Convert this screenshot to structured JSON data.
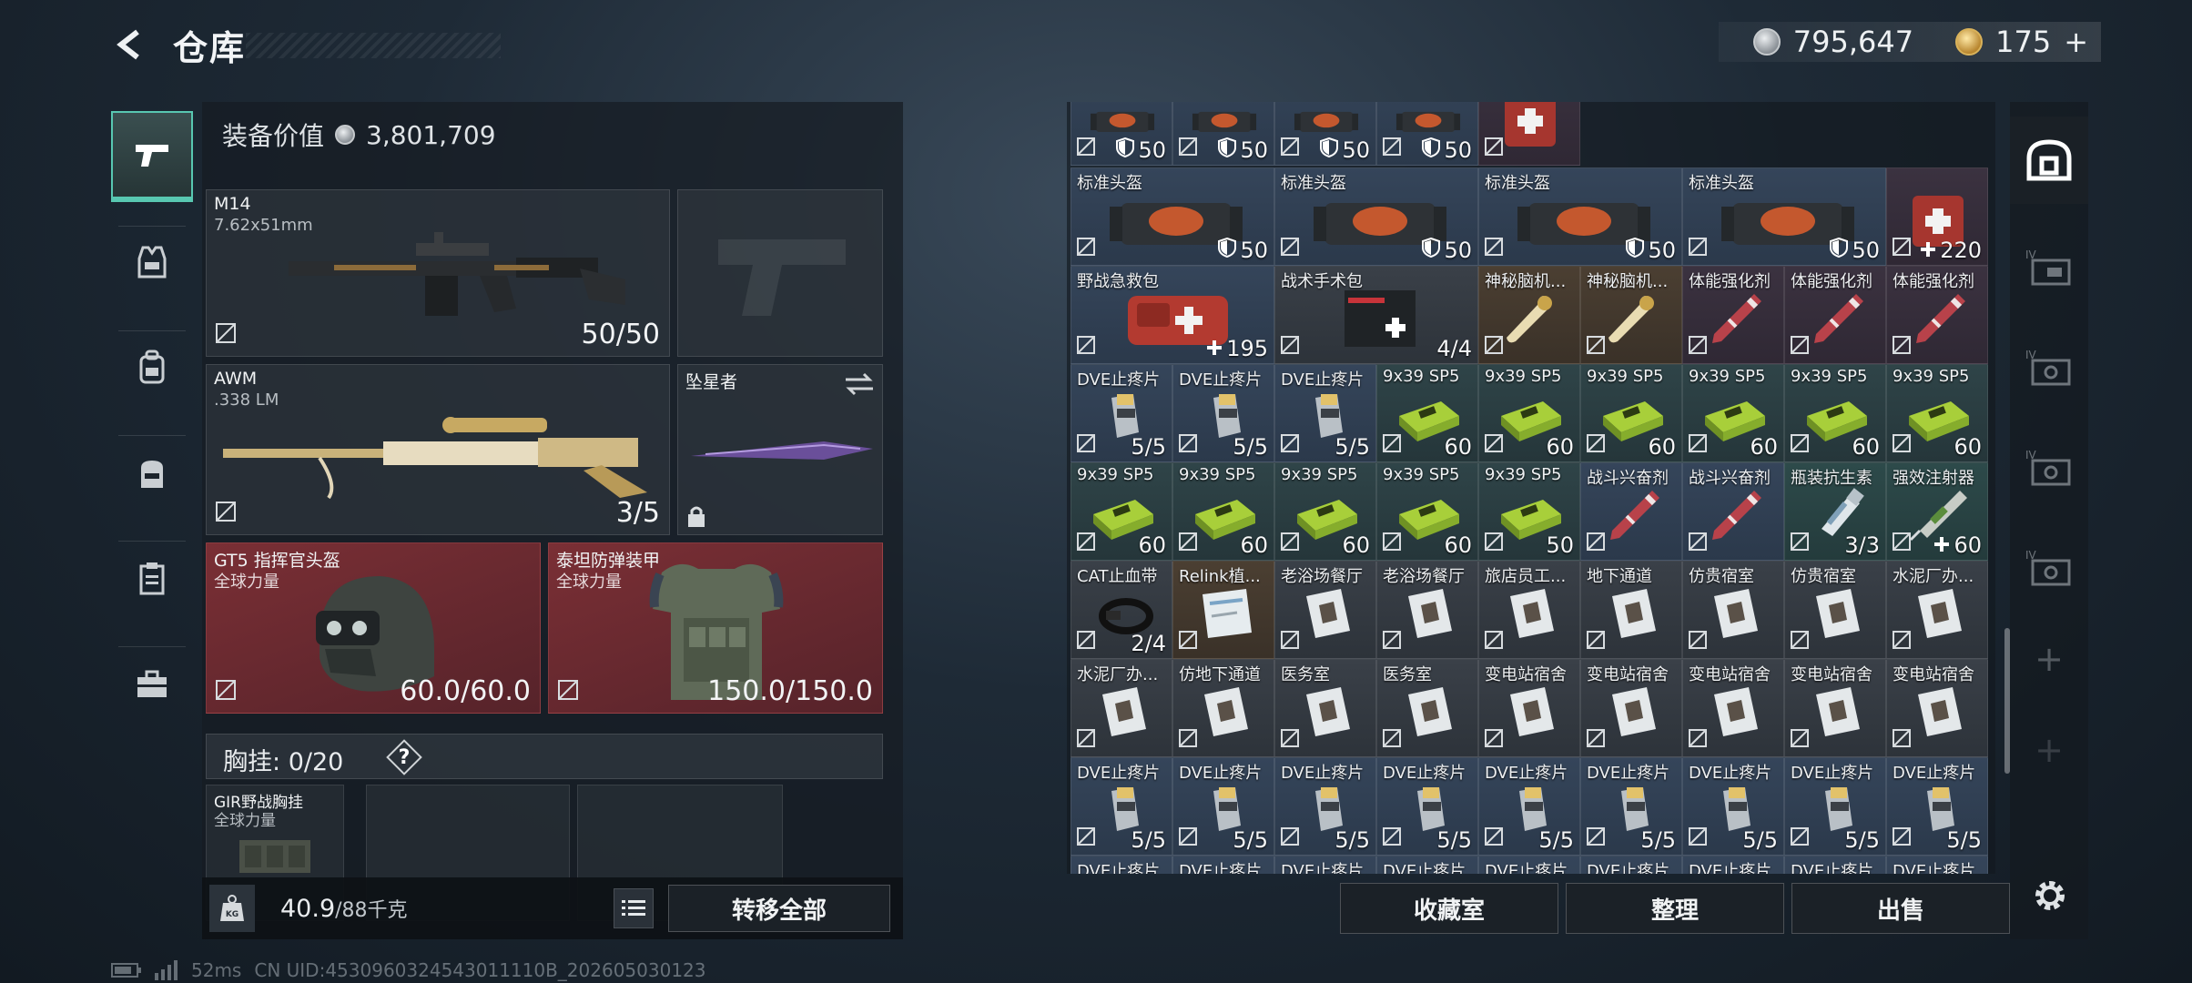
{
  "header": {
    "title": "仓库",
    "silver_amount": "795,647",
    "gold_amount": "175",
    "gold_plus": "+"
  },
  "left_rail": {
    "items": [
      "pistol-icon",
      "vest-icon",
      "backpack-icon",
      "bag-icon",
      "clipboard-icon",
      "toolbox-icon"
    ]
  },
  "equipment": {
    "value_label": "装备价值",
    "value": "3,801,709",
    "primary": {
      "name": "M14",
      "caliber": "7.62x51mm",
      "ammo": "50/50"
    },
    "secondary": {
      "name": "AWM",
      "caliber": ".338 LM",
      "ammo": "3/5"
    },
    "melee": {
      "name": "坠星者"
    },
    "helmet": {
      "name": "GT5 指挥官头盔",
      "tag": "全球力量",
      "durability": "60.0/60.0"
    },
    "armor": {
      "name": "泰坦防弹装甲",
      "tag": "全球力量",
      "durability": "150.0/150.0"
    },
    "chest_rig": {
      "label": "胸挂:",
      "count": "0/20",
      "help": "?",
      "item_name": "GIR野战胸挂",
      "item_tag": "全球力量"
    }
  },
  "bottom_bar": {
    "weight_icon_label": "KG",
    "weight": "40.9",
    "weight_max": "/88千克",
    "transfer_label": "转移全部"
  },
  "status_line": {
    "ping": "52ms",
    "uid": "CN UID:4530960324543011110B_202605030123"
  },
  "warehouse": {
    "rows": [
      [
        {
          "name": "",
          "count": "50",
          "icon": "shield-icon",
          "color": "blue",
          "art": "helmet"
        },
        {
          "name": "",
          "count": "50",
          "icon": "shield-icon",
          "color": "blue",
          "art": "helmet"
        },
        {
          "name": "",
          "count": "50",
          "icon": "shield-icon",
          "color": "blue",
          "art": "helmet"
        },
        {
          "name": "",
          "count": "50",
          "icon": "shield-icon",
          "color": "blue",
          "art": "helmet"
        },
        {
          "name": "",
          "count": "",
          "icon": "",
          "color": "red",
          "art": "medkit-top"
        }
      ],
      [
        {
          "name": "标准头盔",
          "count": "50",
          "icon": "shield-icon",
          "color": "blue",
          "art": "helmet",
          "span": 2
        },
        {
          "name": "标准头盔",
          "count": "50",
          "icon": "shield-icon",
          "color": "blue",
          "art": "helmet",
          "span": 2
        },
        {
          "name": "标准头盔",
          "count": "50",
          "icon": "shield-icon",
          "color": "blue",
          "art": "helmet",
          "span": 2
        },
        {
          "name": "标准头盔",
          "count": "50",
          "icon": "shield-icon",
          "color": "blue",
          "art": "helmet",
          "span": 2
        },
        {
          "name": "",
          "count": "220",
          "icon": "plus-icon",
          "color": "red",
          "art": "medkit"
        }
      ],
      [
        {
          "name": "野战急救包",
          "count": "195",
          "icon": "plus-icon",
          "color": "blue",
          "art": "medbag",
          "span": 2
        },
        {
          "name": "战术手术包",
          "count": "4/4",
          "icon": "",
          "color": "gray",
          "art": "surgery",
          "span": 2
        },
        {
          "name": "神秘脑机...",
          "count": "",
          "icon": "",
          "color": "gold",
          "art": "chip"
        },
        {
          "name": "神秘脑机...",
          "count": "",
          "icon": "",
          "color": "gold",
          "art": "chip"
        },
        {
          "name": "体能强化剂",
          "count": "",
          "icon": "",
          "color": "red",
          "art": "injector"
        },
        {
          "name": "体能强化剂",
          "count": "",
          "icon": "",
          "color": "red",
          "art": "injector"
        },
        {
          "name": "体能强化剂",
          "count": "",
          "icon": "",
          "color": "red",
          "art": "injector"
        }
      ],
      [
        {
          "name": "DVE止疼片",
          "count": "5/5",
          "icon": "",
          "color": "blue",
          "art": "pill"
        },
        {
          "name": "DVE止疼片",
          "count": "5/5",
          "icon": "",
          "color": "blue",
          "art": "pill"
        },
        {
          "name": "DVE止疼片",
          "count": "5/5",
          "icon": "",
          "color": "blue",
          "art": "pill"
        },
        {
          "name": "9x39 SP5",
          "count": "60",
          "icon": "",
          "color": "teal",
          "art": "ammo"
        },
        {
          "name": "9x39 SP5",
          "count": "60",
          "icon": "",
          "color": "teal",
          "art": "ammo"
        },
        {
          "name": "9x39 SP5",
          "count": "60",
          "icon": "",
          "color": "teal",
          "art": "ammo"
        },
        {
          "name": "9x39 SP5",
          "count": "60",
          "icon": "",
          "color": "teal",
          "art": "ammo"
        },
        {
          "name": "9x39 SP5",
          "count": "60",
          "icon": "",
          "color": "teal",
          "art": "ammo"
        },
        {
          "name": "9x39 SP5",
          "count": "60",
          "icon": "",
          "color": "teal",
          "art": "ammo"
        }
      ],
      [
        {
          "name": "9x39 SP5",
          "count": "60",
          "icon": "",
          "color": "teal",
          "art": "ammo"
        },
        {
          "name": "9x39 SP5",
          "count": "60",
          "icon": "",
          "color": "teal",
          "art": "ammo"
        },
        {
          "name": "9x39 SP5",
          "count": "60",
          "icon": "",
          "color": "teal",
          "art": "ammo"
        },
        {
          "name": "9x39 SP5",
          "count": "60",
          "icon": "",
          "color": "teal",
          "art": "ammo"
        },
        {
          "name": "9x39 SP5",
          "count": "50",
          "icon": "",
          "color": "teal",
          "art": "ammo"
        },
        {
          "name": "战斗兴奋剂",
          "count": "",
          "icon": "",
          "color": "blue",
          "art": "injector"
        },
        {
          "name": "战斗兴奋剂",
          "count": "",
          "icon": "",
          "color": "blue",
          "art": "injector"
        },
        {
          "name": "瓶装抗生素",
          "count": "3/3",
          "icon": "",
          "color": "green",
          "art": "bottle"
        },
        {
          "name": "强效注射器",
          "count": "60",
          "icon": "plus-icon",
          "color": "green",
          "art": "syringe"
        }
      ],
      [
        {
          "name": "CAT止血带",
          "count": "2/4",
          "icon": "",
          "color": "gray",
          "art": "tourniquet"
        },
        {
          "name": "Relink植...",
          "count": "",
          "icon": "",
          "color": "gold",
          "art": "card"
        },
        {
          "name": "老浴场餐厅",
          "count": "",
          "icon": "",
          "color": "gray",
          "art": "keycard"
        },
        {
          "name": "老浴场餐厅",
          "count": "",
          "icon": "",
          "color": "gray",
          "art": "keycard"
        },
        {
          "name": "旅店员工...",
          "count": "",
          "icon": "",
          "color": "gray",
          "art": "keycard"
        },
        {
          "name": "地下通道",
          "count": "",
          "icon": "",
          "color": "gray",
          "art": "keycard"
        },
        {
          "name": "仿贵宿室",
          "count": "",
          "icon": "",
          "color": "gray",
          "art": "keycard"
        },
        {
          "name": "仿贵宿室",
          "count": "",
          "icon": "",
          "color": "gray",
          "art": "keycard"
        },
        {
          "name": "水泥厂办...",
          "count": "",
          "icon": "",
          "color": "gray",
          "art": "keycard"
        }
      ],
      [
        {
          "name": "水泥厂办...",
          "count": "",
          "icon": "",
          "color": "gray",
          "art": "keycard"
        },
        {
          "name": "仿地下通道",
          "count": "",
          "icon": "",
          "color": "gray",
          "art": "keycard"
        },
        {
          "name": "医务室",
          "count": "",
          "icon": "",
          "color": "gray",
          "art": "keycard"
        },
        {
          "name": "医务室",
          "count": "",
          "icon": "",
          "color": "gray",
          "art": "keycard"
        },
        {
          "name": "变电站宿舍",
          "count": "",
          "icon": "",
          "color": "gray",
          "art": "keycard"
        },
        {
          "name": "变电站宿舍",
          "count": "",
          "icon": "",
          "color": "gray",
          "art": "keycard"
        },
        {
          "name": "变电站宿舍",
          "count": "",
          "icon": "",
          "color": "gray",
          "art": "keycard"
        },
        {
          "name": "变电站宿舍",
          "count": "",
          "icon": "",
          "color": "gray",
          "art": "keycard"
        },
        {
          "name": "变电站宿舍",
          "count": "",
          "icon": "",
          "color": "gray",
          "art": "keycard"
        }
      ],
      [
        {
          "name": "DVE止疼片",
          "count": "5/5",
          "icon": "",
          "color": "blue",
          "art": "pill"
        },
        {
          "name": "DVE止疼片",
          "count": "5/5",
          "icon": "",
          "color": "blue",
          "art": "pill"
        },
        {
          "name": "DVE止疼片",
          "count": "5/5",
          "icon": "",
          "color": "blue",
          "art": "pill"
        },
        {
          "name": "DVE止疼片",
          "count": "5/5",
          "icon": "",
          "color": "blue",
          "art": "pill"
        },
        {
          "name": "DVE止疼片",
          "count": "5/5",
          "icon": "",
          "color": "blue",
          "art": "pill"
        },
        {
          "name": "DVE止疼片",
          "count": "5/5",
          "icon": "",
          "color": "blue",
          "art": "pill"
        },
        {
          "name": "DVE止疼片",
          "count": "5/5",
          "icon": "",
          "color": "blue",
          "art": "pill"
        },
        {
          "name": "DVE止疼片",
          "count": "5/5",
          "icon": "",
          "color": "blue",
          "art": "pill"
        },
        {
          "name": "DVE止疼片",
          "count": "5/5",
          "icon": "",
          "color": "blue",
          "art": "pill"
        }
      ],
      [
        {
          "name": "DVE止疼片",
          "count": "",
          "icon": "",
          "color": "blue",
          "art": ""
        },
        {
          "name": "DVE止疼片",
          "count": "",
          "icon": "",
          "color": "blue",
          "art": ""
        },
        {
          "name": "DVE止疼片",
          "count": "",
          "icon": "",
          "color": "blue",
          "art": ""
        },
        {
          "name": "DVE止疼片",
          "count": "",
          "icon": "",
          "color": "blue",
          "art": ""
        },
        {
          "name": "DVE止疼片",
          "count": "",
          "icon": "",
          "color": "blue",
          "art": ""
        },
        {
          "name": "DVE止疼片",
          "count": "",
          "icon": "",
          "color": "blue",
          "art": ""
        },
        {
          "name": "DVE止疼片",
          "count": "",
          "icon": "",
          "color": "blue",
          "art": ""
        },
        {
          "name": "DVE止疼片",
          "count": "",
          "icon": "",
          "color": "blue",
          "art": ""
        },
        {
          "name": "DVE止疼片",
          "count": "",
          "icon": "",
          "color": "blue",
          "art": ""
        }
      ]
    ],
    "buttons": {
      "collection": "收藏室",
      "organize": "整理",
      "sell": "出售"
    }
  },
  "right_rail": {
    "items": [
      {
        "icon": "safe-icon",
        "label": ""
      },
      {
        "icon": "case-icon",
        "label": "IV"
      },
      {
        "icon": "case-icon",
        "label": "IV"
      },
      {
        "icon": "case-icon",
        "label": "IV"
      },
      {
        "icon": "case-icon",
        "label": "IV"
      },
      {
        "icon": "plus-icon",
        "label": "+"
      },
      {
        "icon": "plus-icon",
        "label": "+"
      }
    ]
  },
  "colors": {
    "accent": "#58c7b1",
    "gear_red": "#7a2f35",
    "panel": "#161c22"
  }
}
